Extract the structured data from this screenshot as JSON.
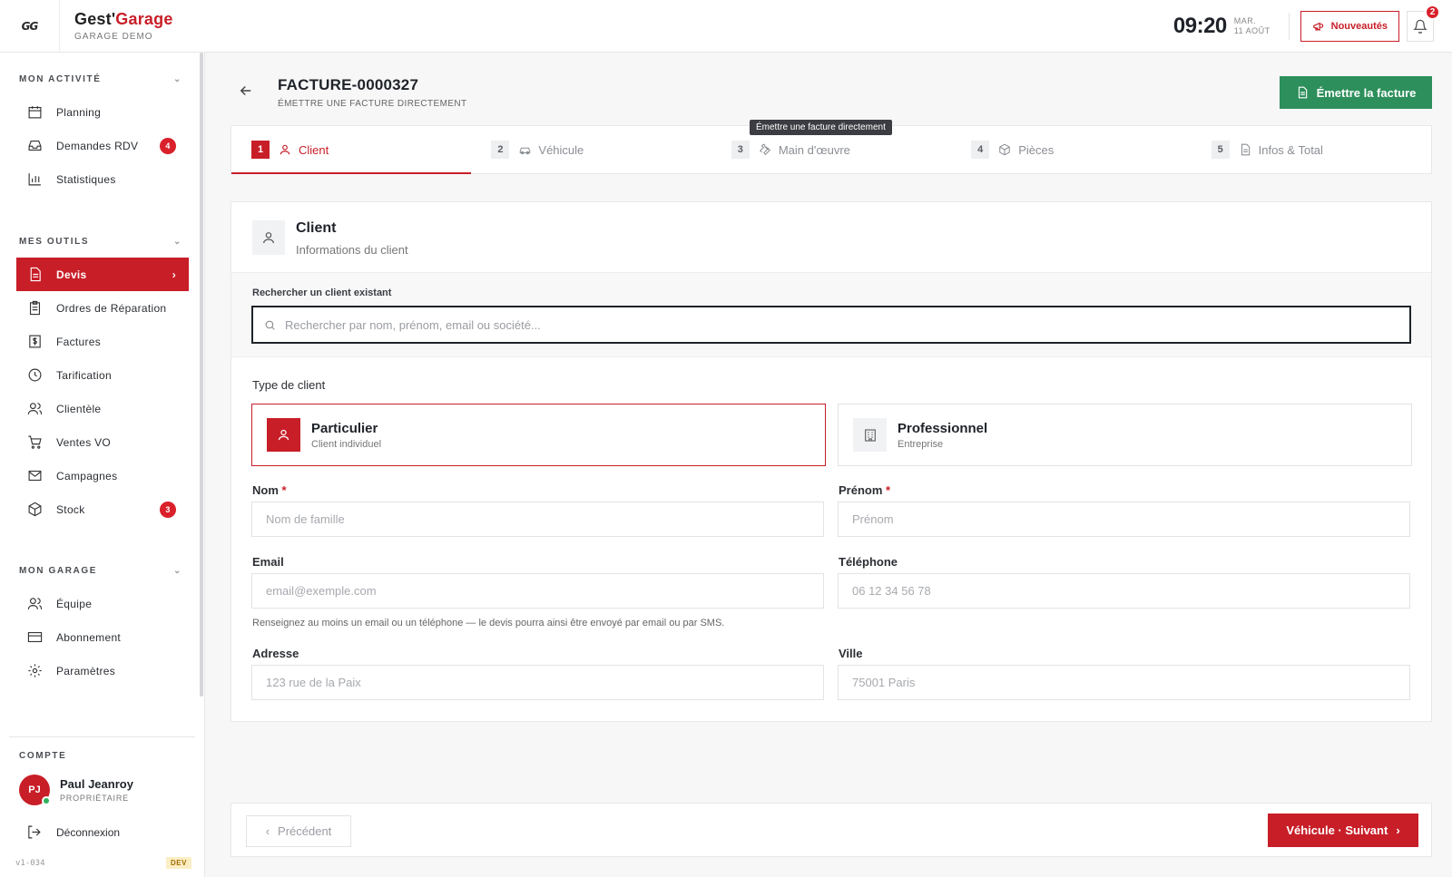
{
  "app": {
    "logo_text": "GG",
    "brand_prefix": "Gest'",
    "brand_suffix": "Garage",
    "garage_name": "GARAGE DEMO"
  },
  "header": {
    "time": "09:20",
    "date_line1": "MAR.",
    "date_line2": "11 AOÛT",
    "news_label": "Nouveautés",
    "notif_count": "2"
  },
  "sidebar": {
    "sections": [
      {
        "title": "MON ACTIVITÉ",
        "items": [
          {
            "label": "Planning",
            "icon": "calendar-icon"
          },
          {
            "label": "Demandes RDV",
            "icon": "inbox-icon",
            "badge": "4"
          },
          {
            "label": "Statistiques",
            "icon": "bar-chart-icon"
          }
        ]
      },
      {
        "title": "MES OUTILS",
        "items": [
          {
            "label": "Devis",
            "icon": "document-icon",
            "active": true
          },
          {
            "label": "Ordres de Réparation",
            "icon": "clipboard-icon"
          },
          {
            "label": "Factures",
            "icon": "invoice-icon"
          },
          {
            "label": "Tarification",
            "icon": "clock-icon"
          },
          {
            "label": "Clientèle",
            "icon": "users-icon"
          },
          {
            "label": "Ventes VO",
            "icon": "cart-icon"
          },
          {
            "label": "Campagnes",
            "icon": "mail-icon"
          },
          {
            "label": "Stock",
            "icon": "box-icon",
            "badge": "3"
          }
        ]
      },
      {
        "title": "MON GARAGE",
        "items": [
          {
            "label": "Équipe",
            "icon": "team-icon"
          },
          {
            "label": "Abonnement",
            "icon": "card-icon"
          },
          {
            "label": "Paramètres",
            "icon": "gear-icon"
          }
        ]
      }
    ],
    "account_title": "COMPTE",
    "user_initials": "PJ",
    "user_name": "Paul Jeanroy",
    "user_role": "PROPRIÉTAIRE",
    "logout_label": "Déconnexion",
    "version": "v1-034",
    "env_badge": "DEV"
  },
  "page": {
    "title": "FACTURE-0000327",
    "subtitle": "ÉMETTRE UNE FACTURE DIRECTEMENT",
    "emit_button": "Émettre la facture",
    "tooltip": "Émettre une facture directement"
  },
  "steps": [
    {
      "num": "1",
      "label": "Client",
      "icon": "user-icon",
      "active": true
    },
    {
      "num": "2",
      "label": "Véhicule",
      "icon": "car-icon"
    },
    {
      "num": "3",
      "label": "Main d'œuvre",
      "icon": "wrench-icon"
    },
    {
      "num": "4",
      "label": "Pièces",
      "icon": "box-icon"
    },
    {
      "num": "5",
      "label": "Infos & Total",
      "icon": "document-icon"
    }
  ],
  "client_card": {
    "title": "Client",
    "subtitle": "Informations du client",
    "search_label": "Rechercher un client existant",
    "search_placeholder": "Rechercher par nom, prénom, email ou société...",
    "type_label": "Type de client",
    "types": [
      {
        "title": "Particulier",
        "subtitle": "Client individuel",
        "selected": true
      },
      {
        "title": "Professionnel",
        "subtitle": "Entreprise",
        "selected": false
      }
    ],
    "fields": {
      "nom_label": "Nom",
      "nom_placeholder": "Nom de famille",
      "prenom_label": "Prénom",
      "prenom_placeholder": "Prénom",
      "email_label": "Email",
      "email_placeholder": "email@exemple.com",
      "tel_label": "Téléphone",
      "tel_placeholder": "06 12 34 56 78",
      "adresse_label": "Adresse",
      "adresse_placeholder": "123 rue de la Paix",
      "ville_label": "Ville",
      "ville_placeholder": "75001 Paris",
      "required_mark": "*"
    },
    "hint": "Renseignez au moins un email ou un téléphone — le devis pourra ainsi être envoyé par email ou par SMS."
  },
  "footer": {
    "prev_label": "Précédent",
    "next_label": "Véhicule · Suivant"
  },
  "colors": {
    "brand_red": "#c81e28",
    "green": "#2d8f5b"
  }
}
